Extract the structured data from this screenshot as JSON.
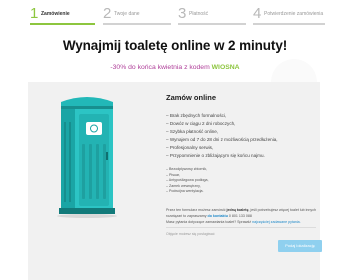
{
  "steps": [
    {
      "num": "1",
      "label": "Zamówienie",
      "active": true
    },
    {
      "num": "2",
      "label": "Twoje dane",
      "active": false
    },
    {
      "num": "3",
      "label": "Płatność",
      "active": false
    },
    {
      "num": "4",
      "label": "Potwierdzenie zamówienia",
      "active": false
    }
  ],
  "headline": "Wynajmij toaletę online w 2 minuty!",
  "promo": {
    "text": "-30% do końca kwietnia z kodem ",
    "code": "WIOSNA"
  },
  "product": {
    "title": "Zamów online",
    "features": [
      "– Brak zbędnych formalności,",
      "– Dowóz w ciągu 2 dni roboczych,",
      "– Szybka płatność online,",
      "– Wynajem od 7 do 28 dni z możliwością przedłużenia,",
      "– Profesjonalny serwis,",
      "– Przypomnienie o zbliżającym się końcu najmu."
    ],
    "specs": [
      "– Bezodpływowy zbiornik,",
      "– Pisuar,",
      "– Antypoślizgowa podłoga,",
      "– Zamek wewnętrzny,",
      "– Podwójna wentylacja."
    ],
    "note": {
      "part1": "Przez ten formularz możesz zamówić ",
      "bold1": "jedną toaletę",
      "part2": ", jeśli potrzebujesz więcej toalet lub innych rozwiązań to zapraszamy ",
      "bold2": "do kontaktu",
      "phone": " 0 801 133 088",
      "part3": "Masz pytania dotyczące zamawiania toalet? Sprawdź ",
      "link": "najczęściej zadawane pytania."
    },
    "back_link": "Objęcie możesz się posługiwać",
    "next_button": "Podaj lokalizację"
  },
  "colors": {
    "accent": "#8dc63f",
    "promo": "#b0409a",
    "button": "#8fd0ef",
    "toilet": "#1fb5b5"
  },
  "illustration": "portable-toilet-image"
}
